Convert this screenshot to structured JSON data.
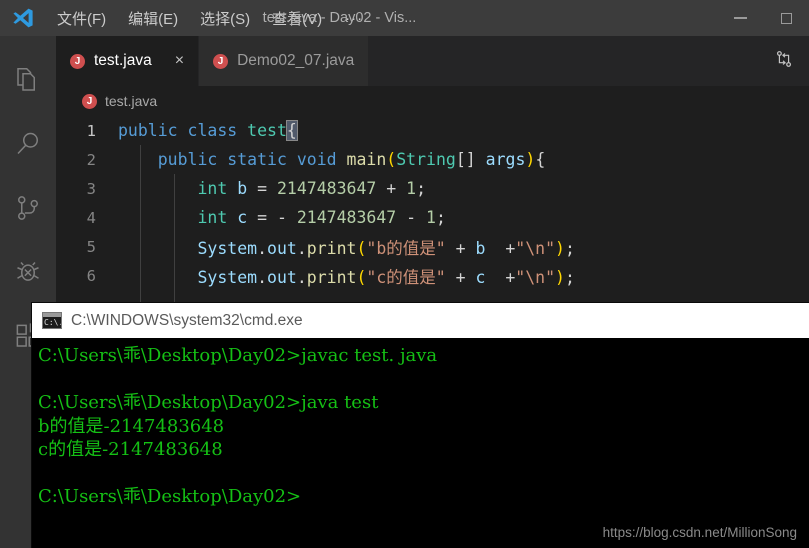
{
  "window": {
    "title": "test.java - Day02 - Vis...",
    "logo_name": "vscode-logo",
    "menus": [
      {
        "label": "文件(F)",
        "name": "menu-file"
      },
      {
        "label": "编辑(E)",
        "name": "menu-edit"
      },
      {
        "label": "选择(S)",
        "name": "menu-selection"
      },
      {
        "label": "查看(V)",
        "name": "menu-view"
      }
    ],
    "more_label": "···",
    "controls": {
      "minimize": "minimize-button",
      "maximize": "maximize-button"
    }
  },
  "activitybar": {
    "items": [
      {
        "name": "explorer-icon",
        "label": "Explorer"
      },
      {
        "name": "search-icon",
        "label": "Search"
      },
      {
        "name": "source-control-icon",
        "label": "Source Control"
      },
      {
        "name": "debug-icon",
        "label": "Run and Debug"
      },
      {
        "name": "extensions-icon",
        "label": "Extensions"
      }
    ]
  },
  "tabs": [
    {
      "label": "test.java",
      "icon": "J",
      "active": true,
      "close": "×"
    },
    {
      "label": "Demo02_07.java",
      "icon": "J",
      "active": false
    }
  ],
  "tabbar_action": {
    "name": "compare-changes-icon"
  },
  "breadcrumb": {
    "icon": "J",
    "label": "test.java"
  },
  "editor": {
    "lines": [
      {
        "no": "1",
        "active": true
      },
      {
        "no": "2",
        "active": false
      },
      {
        "no": "3",
        "active": false
      },
      {
        "no": "4",
        "active": false
      },
      {
        "no": "5",
        "active": false
      },
      {
        "no": "6",
        "active": false
      }
    ],
    "code": [
      "public class test{",
      "    public static void main(String[] args){",
      "        int b = 2147483647 + 1;",
      "        int c = - 2147483647 - 1;",
      "        System.out.print(\"b的值是\" + b  +\"\\n\");",
      "        System.out.print(\"c的值是\" + c  +\"\\n\");"
    ]
  },
  "cmd": {
    "title": "C:\\WINDOWS\\system32\\cmd.exe",
    "icon_text": "C:\\.",
    "lines": [
      "C:\\Users\\乖\\Desktop\\Day02>javac test. java",
      "",
      "C:\\Users\\乖\\Desktop\\Day02>java test",
      "b的值是-2147483648",
      "c的值是-2147483648",
      "",
      "C:\\Users\\乖\\Desktop\\Day02>"
    ]
  },
  "watermark": "https://blog.csdn.net/MillionSong",
  "colors": {
    "titlebar": "#3c3c3c",
    "activitybar": "#333333",
    "editor_bg": "#1e1e1e",
    "tab_inactive": "#2d2d2d",
    "console_green": "#15c015",
    "java_icon": "#cf4f4f"
  }
}
